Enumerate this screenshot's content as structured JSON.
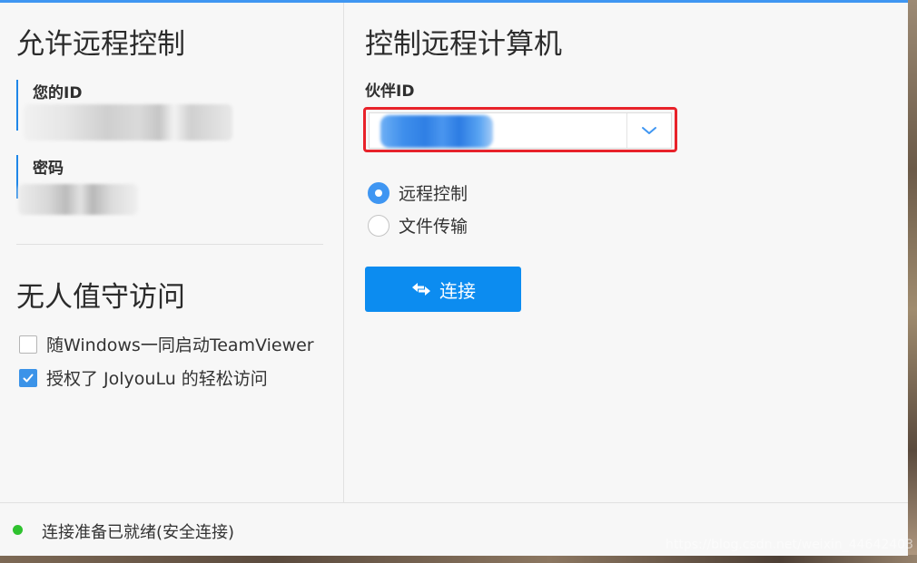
{
  "left": {
    "title": "允许远程控制",
    "your_id_label": "您的ID",
    "password_label": "密码",
    "unattended_title": "无人值守访问",
    "checkbox_start_windows": {
      "label": "随Windows一同启动TeamViewer",
      "checked": false
    },
    "checkbox_grant_access": {
      "label": "授权了 JolyouLu 的轻松访问",
      "checked": true
    }
  },
  "right": {
    "title": "控制远程计算机",
    "partner_id_label": "伙伴ID",
    "radio_remote_control": {
      "label": "远程控制",
      "selected": true
    },
    "radio_file_transfer": {
      "label": "文件传输",
      "selected": false
    },
    "connect_button": "连接"
  },
  "status": {
    "text": "连接准备已就绪(安全连接)",
    "color": "#2fc22f"
  },
  "watermark": "https://blog.csdn.net/weixin_44642403",
  "colors": {
    "accent": "#3f96f2",
    "button": "#0c8cf0",
    "highlight": "#e8222a"
  }
}
